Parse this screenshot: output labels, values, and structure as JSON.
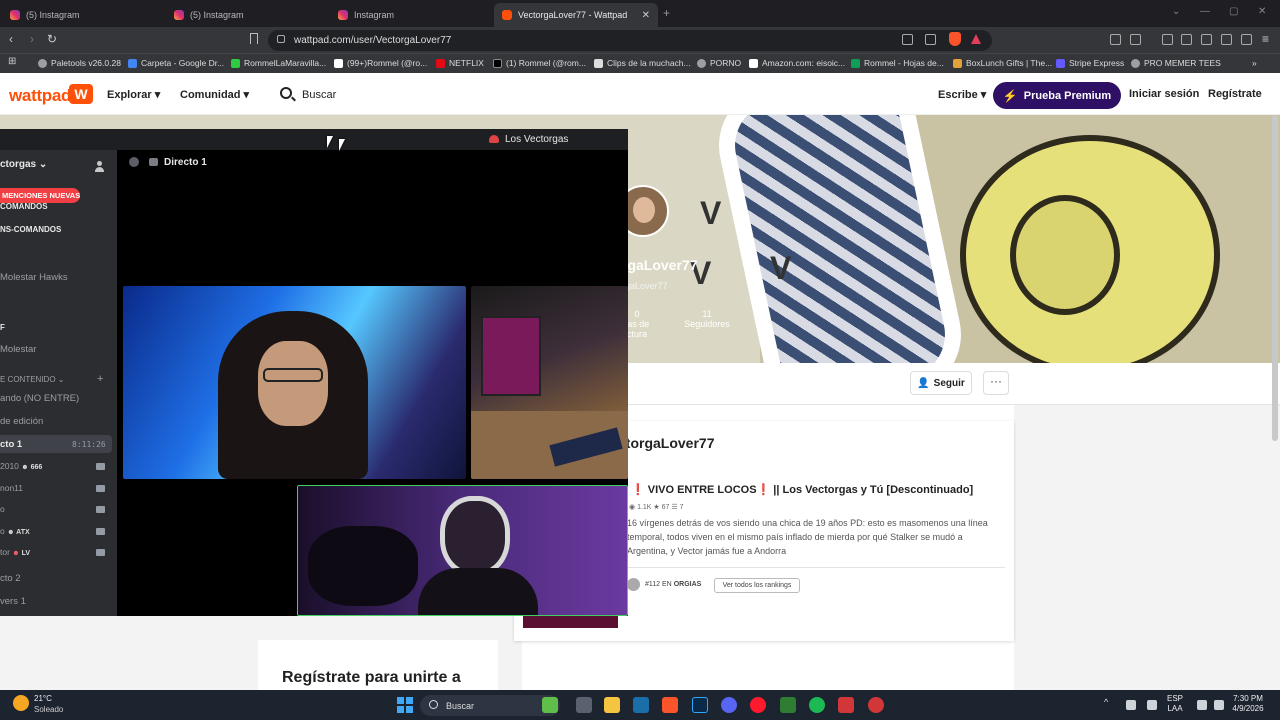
{
  "browser": {
    "tabs": [
      {
        "label": "(5) Instagram",
        "active": false,
        "icon": "instagram-icon"
      },
      {
        "label": "(5) Instagram",
        "active": false,
        "icon": "instagram-icon"
      },
      {
        "label": "Instagram",
        "active": false,
        "icon": "instagram-icon"
      },
      {
        "label": "VectorgaLover77 - Wattpad",
        "active": true,
        "icon": "wattpad-icon"
      }
    ],
    "url": "wattpad.com/user/VectorgaLover77",
    "bookmarks": [
      {
        "label": "Paletools v26.0.28",
        "color": "#9aa0a6"
      },
      {
        "label": "Carpeta - Google Dr...",
        "color": "#4285f4"
      },
      {
        "label": "RommelLaMaravilla...",
        "color": "#2ecc40"
      },
      {
        "label": "(99+)Rommel (@ro...",
        "color": "#ffffff"
      },
      {
        "label": "NETFLIX",
        "color": "#e50914"
      },
      {
        "label": "(1) Rommel (@rom...",
        "color": "#000000"
      },
      {
        "label": "Clips de la muchach...",
        "color": "#dddddd"
      },
      {
        "label": "PORNO",
        "color": "#9aa0a6"
      },
      {
        "label": "Amazon.com: eisoic...",
        "color": "#ffffff"
      },
      {
        "label": "Rommel - Hojas de...",
        "color": "#0f9d58"
      },
      {
        "label": "BoxLunch Gifts | The...",
        "color": "#e2a23b"
      },
      {
        "label": "Stripe Express",
        "color": "#635bff"
      },
      {
        "label": "PRO MEMER TEES",
        "color": "#9aa0a6"
      }
    ]
  },
  "wattpad": {
    "logo": "wattpad",
    "nav": {
      "explore": "Explorar",
      "community": "Comunidad",
      "search": "Buscar"
    },
    "write": "Escribe",
    "premium": "Prueba Premium",
    "login": "Iniciar sesión",
    "register": "Regístrate",
    "profile": {
      "name_partial": "rgaLover77",
      "username_partial": "rgaLover77",
      "reading_lists_count": "0",
      "reading_lists_label_1": "tas de",
      "reading_lists_label_2": "ctura",
      "followers_count": "11",
      "followers_label": "Seguidores"
    },
    "follow": "Seguir",
    "more": "···",
    "stories_title": "ctorgaLover77",
    "story": {
      "title": "❗ VIVO ENTRE LOCOS❗ || Los Vectorgas y Tú [Descontinuado]",
      "reads": "1.1K",
      "votes": "67",
      "parts": "7",
      "description": "16 vírgenes detrás de vos siendo una chica de 19 años PD: esto es masomenos una línea temporal, todos viven en el mismo país inflado de mierda por qué Stalker se mudó a Argentina, y Vector jamás fue a Andorra",
      "rank": "#112",
      "rank_in": "EN",
      "rank_tag": "ORGIAS",
      "rank_button": "Ver todos los rankings"
    },
    "signup_heading": "Regístrate para unirte a"
  },
  "discord": {
    "server_title": "Los Vectorgas",
    "server_name": "ctorgas",
    "mentions_pill": "MENCIONES NUEVAS",
    "channels": [
      {
        "label": "COMANDOS",
        "bold": true,
        "small": true
      },
      {
        "label": "NS-COMANDOS",
        "bold": true,
        "small": true
      },
      {
        "label": "Molestar Hawks",
        "bold": false
      },
      {
        "label": "F",
        "bold": true,
        "small": true
      },
      {
        "label": "Molestar",
        "bold": false
      },
      {
        "label": "E CONTENIDO",
        "bold": false,
        "small": true
      },
      {
        "label": "ando (NO ENTRE)",
        "bold": false
      },
      {
        "label": "de edición",
        "bold": false
      },
      {
        "label": "cto 1",
        "bold": true,
        "selected": true
      },
      {
        "label": "2010",
        "bold": false
      },
      {
        "label": "non11",
        "bold": false
      },
      {
        "label": "o",
        "bold": false
      },
      {
        "label": "o",
        "bold": false
      },
      {
        "label": "tor",
        "bold": false
      },
      {
        "label": "cto 2",
        "bold": false
      },
      {
        "label": "vers 1",
        "bold": false
      }
    ],
    "selected_timer": "8:11:26",
    "tags": {
      "t2010": "666",
      "to": "ATX",
      "ttor": "LV"
    },
    "current_channel": "Directo 1"
  },
  "taskbar": {
    "temperature": "21°C",
    "condition": "Soleado",
    "search": "Buscar",
    "lang1": "ESP",
    "lang2": "LAA",
    "time": "7:30 PM",
    "date": "4/9/2026",
    "apps": [
      "windows-explorer",
      "file-explorer",
      "steam",
      "brave",
      "photoshop",
      "discord",
      "opera",
      "spotify",
      "riot"
    ]
  }
}
